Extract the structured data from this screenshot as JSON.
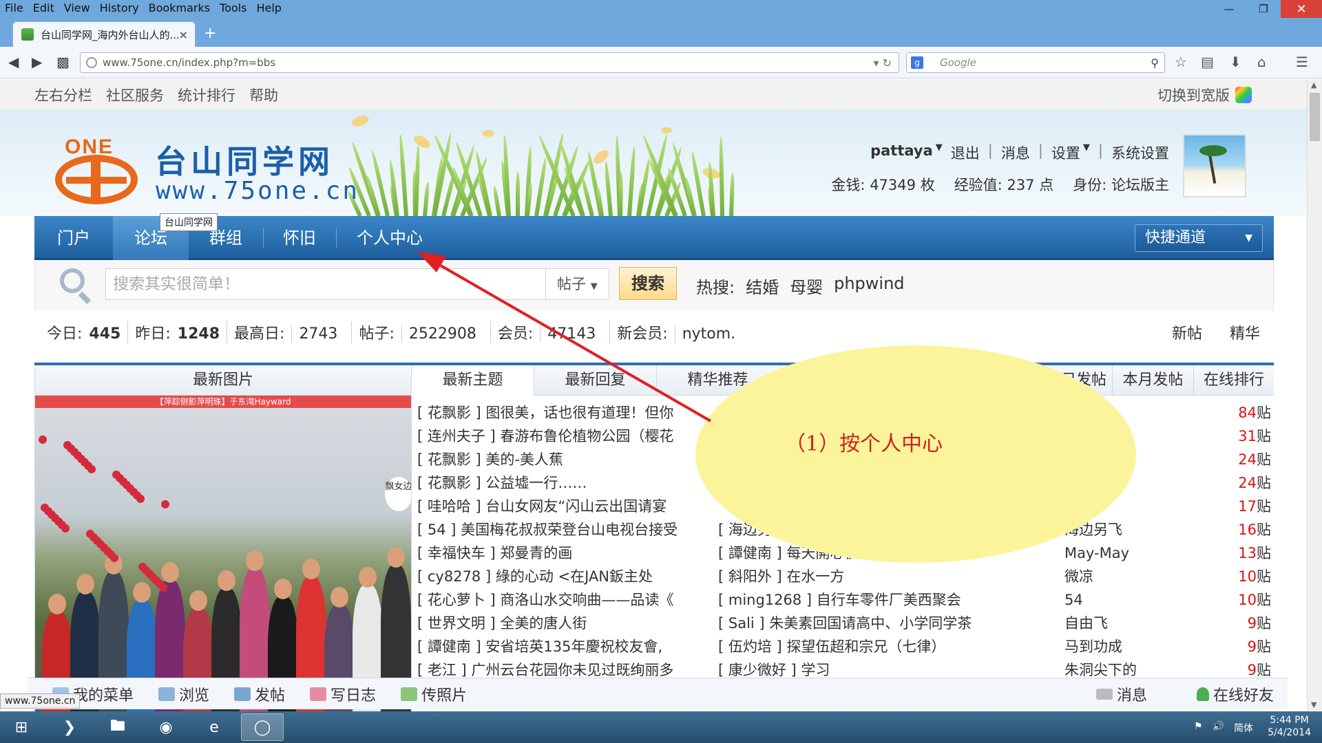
{
  "browser": {
    "menu": [
      "File",
      "Edit",
      "View",
      "History",
      "Bookmarks",
      "Tools",
      "Help"
    ],
    "tab_title": "台山同学网_海内外台山人的...",
    "url": "www.75one.cn/index.php?m=bbs",
    "search_placeholder": "Google",
    "status_url": "www.75one.cn"
  },
  "topnav": {
    "links": [
      "左右分栏",
      "社区服务",
      "统计排行",
      "帮助"
    ],
    "switch": "切换到宽版"
  },
  "banner": {
    "logo_badge": "ONE",
    "site_title": "台山同学网",
    "site_url": "www.75one.cn",
    "tooltip": "台山同学网"
  },
  "user": {
    "name": "pattaya",
    "links": [
      "退出",
      "消息",
      "设置",
      "系统设置"
    ],
    "money_label": "金钱:",
    "money": "47349",
    "money_unit": "枚",
    "exp_label": "经验值:",
    "exp": "237",
    "exp_unit": "点",
    "role_label": "身份:",
    "role": "论坛版主"
  },
  "mainnav": {
    "items": [
      "门户",
      "论坛",
      "群组",
      "怀旧",
      "个人中心"
    ],
    "active_index": 1,
    "quick": "快捷通道"
  },
  "search": {
    "placeholder": "搜索其实很简单！",
    "type": "帖子",
    "button": "搜索",
    "hot_label": "热搜:",
    "hot": [
      "结婚",
      "母婴",
      "phpwind"
    ]
  },
  "stats": {
    "today_label": "今日:",
    "today": "445",
    "yesterday_label": "昨日:",
    "yesterday": "1248",
    "max_label": "最高日:",
    "max": "2743",
    "posts_label": "帖子:",
    "posts": "2522908",
    "members_label": "会员:",
    "members": "47143",
    "newest_label": "新会员:",
    "newest": "nytom.",
    "links": [
      "新帖",
      "精华"
    ]
  },
  "pictures": {
    "title": "最新图片",
    "caption": "【萍踪侧影萍明珠】于东湾Hayward",
    "badge": "飘女边"
  },
  "tabs": [
    "最新主题",
    "最新回复",
    "精华推荐",
    "今日发帖",
    "本月发帖",
    "在线排行"
  ],
  "topics": [
    {
      "cat": "花飘影",
      "title": "图很美，话也很有道理！但你"
    },
    {
      "cat": "连州夫子",
      "title": "春游布鲁伦植物公园（樱花"
    },
    {
      "cat": "花飘影",
      "title": "美的-美人蕉"
    },
    {
      "cat": "花飘影",
      "title": "公益墟一行……"
    },
    {
      "cat": "哇哈哈",
      "title": "台山女网友“闪山云出国请宴"
    },
    {
      "cat": "54",
      "title": "美国梅花叔叔荣登台山电视台接受"
    },
    {
      "cat": "幸福快车",
      "title": "郑曼青的画"
    },
    {
      "cat": "cy8278",
      "title": "綠的心动 <在JAN鈑主处"
    },
    {
      "cat": "花心萝卜",
      "title": "商洛山水交响曲——品读《"
    },
    {
      "cat": "世界文明",
      "title": "全美的唐人街"
    },
    {
      "cat": "譚健南",
      "title": "安省培英135年慶祝校友會,"
    },
    {
      "cat": "老江",
      "title": "广州云台花园你未见过既绚丽多"
    }
  ],
  "replies": [
    {
      "cat": "",
      "title": ""
    },
    {
      "cat": "",
      "title": ""
    },
    {
      "cat": "",
      "title": ""
    },
    {
      "cat": "",
      "title": ""
    },
    {
      "cat": "",
      "title": ""
    },
    {
      "cat": "海边另",
      "title": ""
    },
    {
      "cat": "譚健南",
      "title": "每天開心快樂"
    },
    {
      "cat": "斜阳外",
      "title": "在水一方"
    },
    {
      "cat": "ming1268",
      "title": "自行车零件厂美西聚会"
    },
    {
      "cat": "Sali",
      "title": "朱美素回国请高中、小学同学茶"
    },
    {
      "cat": "伍灼培",
      "title": "探望伍超和宗兄（七律）"
    },
    {
      "cat": "康少微好",
      "title": "学习"
    }
  ],
  "ranking": [
    {
      "name": "",
      "count": "84",
      "unit": "贴"
    },
    {
      "name": "",
      "count": "31",
      "unit": "贴"
    },
    {
      "name": "",
      "count": "24",
      "unit": "贴"
    },
    {
      "name": "",
      "count": "24",
      "unit": "贴"
    },
    {
      "name": "",
      "count": "17",
      "unit": "贴"
    },
    {
      "name": "海边另飞",
      "count": "16",
      "unit": "贴"
    },
    {
      "name": "May-May",
      "count": "13",
      "unit": "贴"
    },
    {
      "name": "微凉",
      "count": "10",
      "unit": "贴"
    },
    {
      "name": "54",
      "count": "10",
      "unit": "贴"
    },
    {
      "name": "自由飞",
      "count": "9",
      "unit": "贴"
    },
    {
      "name": "马到功成",
      "count": "9",
      "unit": "贴"
    },
    {
      "name": "朱洞尖下的",
      "count": "9",
      "unit": "贴"
    }
  ],
  "annotation": {
    "text": "（1）按个人中心",
    "color": "#e02020",
    "bubble_color": "#fbf49b"
  },
  "bottombar": {
    "left": [
      "我的菜单",
      "浏览",
      "发帖",
      "写日志",
      "传照片"
    ],
    "right": [
      "消息",
      "在线好友"
    ]
  },
  "taskbar": {
    "ime": "简体",
    "time": "5:44 PM",
    "date": "5/4/2014"
  },
  "colors": {
    "nav_blue": "#1f5f9e",
    "accent_orange": "#e8681c",
    "count_red": "#d11111"
  }
}
